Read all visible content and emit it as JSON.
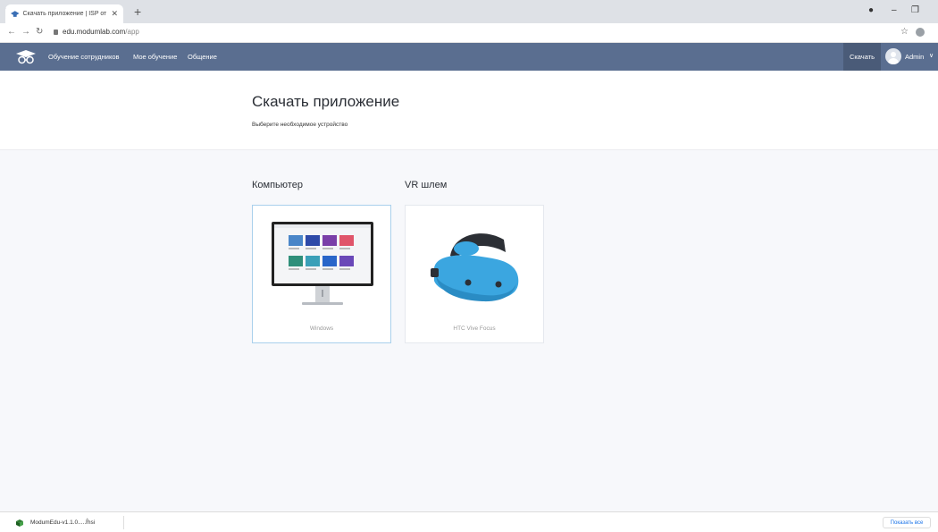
{
  "browser": {
    "tab_title": "Скачать приложение | ISP от М",
    "url_domain": "edu.modumlab.com",
    "url_path": "/app"
  },
  "appnav": {
    "links": [
      "Обучение сотрудников",
      "Мое обучение",
      "Общение"
    ],
    "download_label": "Скачать",
    "user_name": "Admin"
  },
  "header": {
    "title": "Скачать приложение",
    "subtitle": "Выберите необходимое устройство"
  },
  "categories": [
    {
      "title": "Компьютер",
      "device": "Windows"
    },
    {
      "title": "VR шлем",
      "device": "HTC Vive Focus"
    }
  ],
  "download_bar": {
    "file_name": "ModumEdu-v1.1.0.....msi",
    "show_all": "Показать все"
  },
  "colors": {
    "nav_bg": "#5a6e90",
    "accent_selected": "#a9d0ec",
    "headset_blue": "#3ba6e0"
  }
}
